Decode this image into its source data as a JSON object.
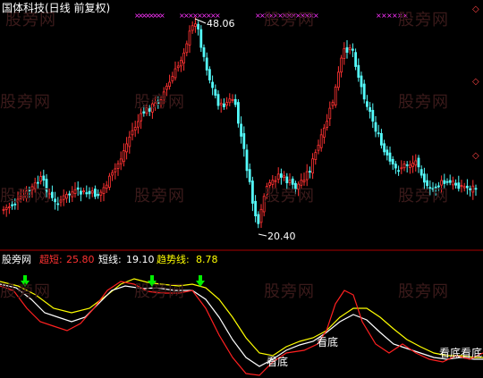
{
  "header": {
    "title": "国体科技(日线 前复权)",
    "diamond_icon": "◇",
    "colors": {
      "title": "#ffffff",
      "diamond": "#ff4444",
      "marker": "#ff33ff"
    }
  },
  "main_chart": {
    "high_label": "48.06",
    "low_label": "20.40",
    "up_color": "#ff3232",
    "down_color": "#54fcfc"
  },
  "indicator": {
    "name": "股旁网",
    "items": [
      {
        "label": "超短:",
        "value": "25.80",
        "color": "#ff3232"
      },
      {
        "label": "短线:",
        "value": "19.10",
        "color": "#ffffff"
      },
      {
        "label": "趋势线:",
        "value": "8.78",
        "color": "#ffff00"
      }
    ],
    "annotations": [
      "看底",
      "看底",
      "看底看底"
    ],
    "arrow_icon": "down-arrow-icon",
    "arrow_color": "#00ee00"
  },
  "watermark": "股旁网"
}
